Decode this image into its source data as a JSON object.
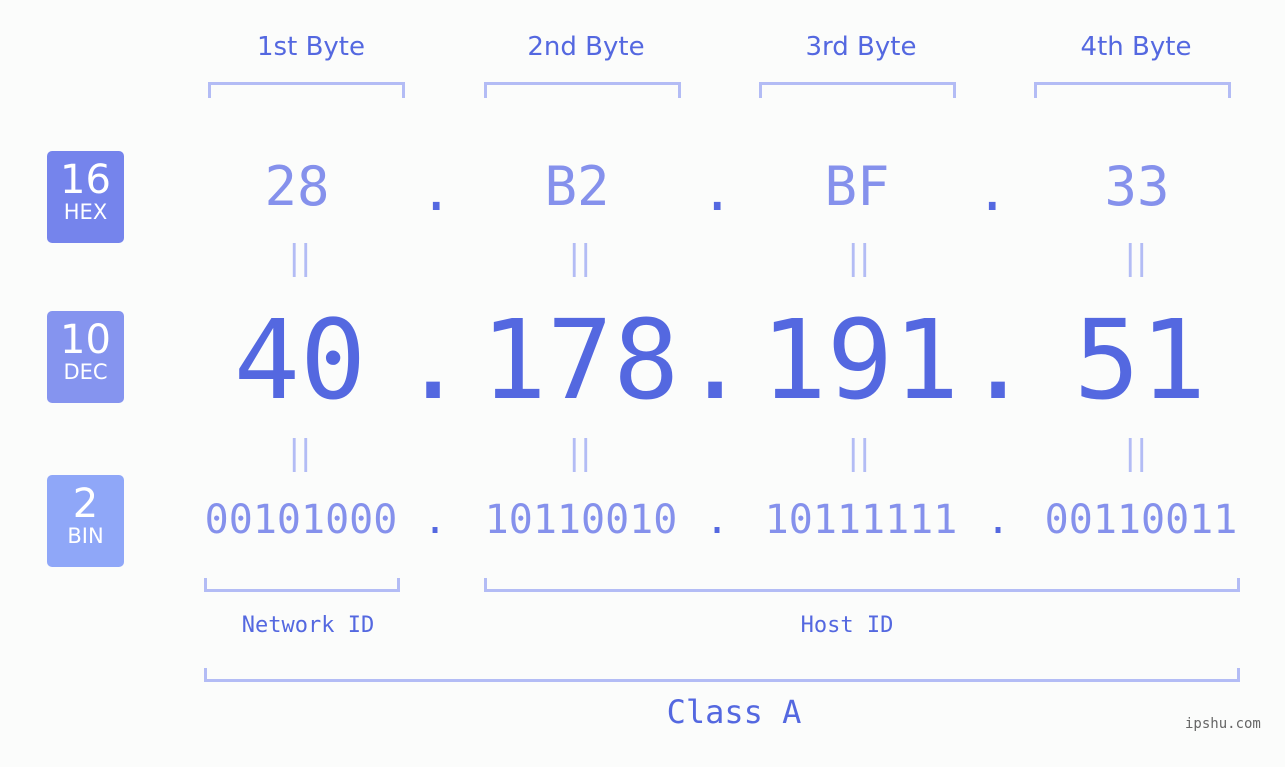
{
  "colors": {
    "hex_badge": "#7584ec",
    "dec_badge": "#8594ef",
    "bin_badge": "#8fa7f8",
    "accent": "#5468e0",
    "light": "#8591ec",
    "bracket": "#b3bcf5"
  },
  "badges": [
    {
      "num": "16",
      "label": "HEX"
    },
    {
      "num": "10",
      "label": "DEC"
    },
    {
      "num": "2",
      "label": "BIN"
    }
  ],
  "bytes": [
    {
      "header": "1st Byte",
      "hex": "28",
      "dec": "40",
      "bin": "00101000"
    },
    {
      "header": "2nd Byte",
      "hex": "B2",
      "dec": "178",
      "bin": "10110010"
    },
    {
      "header": "3rd Byte",
      "hex": "BF",
      "dec": "191",
      "bin": "10111111"
    },
    {
      "header": "4th Byte",
      "hex": "33",
      "dec": "51",
      "bin": "00110011"
    }
  ],
  "separator": ".",
  "equals": "||",
  "network_label": "Network ID",
  "host_label": "Host ID",
  "class_label": "Class A",
  "watermark": "ipshu.com"
}
